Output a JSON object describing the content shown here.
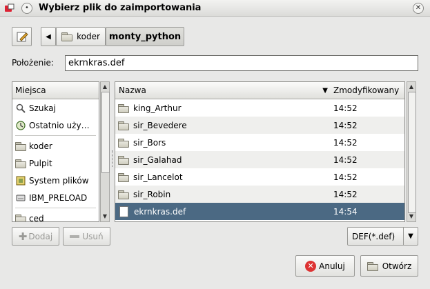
{
  "window": {
    "title": "Wybierz plik do zaimportowania"
  },
  "path_bar": {
    "segments": [
      "koder",
      "monty_python"
    ]
  },
  "location": {
    "label": "Położenie:",
    "value": "ekrnkras.def"
  },
  "places": {
    "header": "Miejsca",
    "items": [
      {
        "label": "Szukaj",
        "icon": "magnifier-icon"
      },
      {
        "label": "Ostatnio uży…",
        "icon": "recent-clock-icon"
      },
      {
        "label": "koder",
        "icon": "folder-icon"
      },
      {
        "label": "Pulpit",
        "icon": "folder-icon"
      },
      {
        "label": "System plików",
        "icon": "filesystem-icon"
      },
      {
        "label": "IBM_PRELOAD",
        "icon": "drive-icon"
      },
      {
        "label": "ced",
        "icon": "folder-icon"
      }
    ],
    "add_label": "Dodaj",
    "remove_label": "Usuń"
  },
  "files": {
    "columns": {
      "name": "Nazwa",
      "modified": "Zmodyfikowany"
    },
    "rows": [
      {
        "name": "king_Arthur",
        "modified": "14:52",
        "type": "folder"
      },
      {
        "name": "sir_Bevedere",
        "modified": "14:52",
        "type": "folder"
      },
      {
        "name": "sir_Bors",
        "modified": "14:52",
        "type": "folder"
      },
      {
        "name": "sir_Galahad",
        "modified": "14:52",
        "type": "folder"
      },
      {
        "name": "sir_Lancelot",
        "modified": "14:52",
        "type": "folder"
      },
      {
        "name": "sir_Robin",
        "modified": "14:52",
        "type": "folder"
      },
      {
        "name": "ekrnkras.def",
        "modified": "14:54",
        "type": "file",
        "selected": true
      }
    ]
  },
  "filter": {
    "value": "DEF(*.def)"
  },
  "actions": {
    "cancel_label": "Anuluj",
    "open_label": "Otwórz"
  },
  "colors": {
    "selection": "#4b6983",
    "background": "#e8e8e7"
  }
}
